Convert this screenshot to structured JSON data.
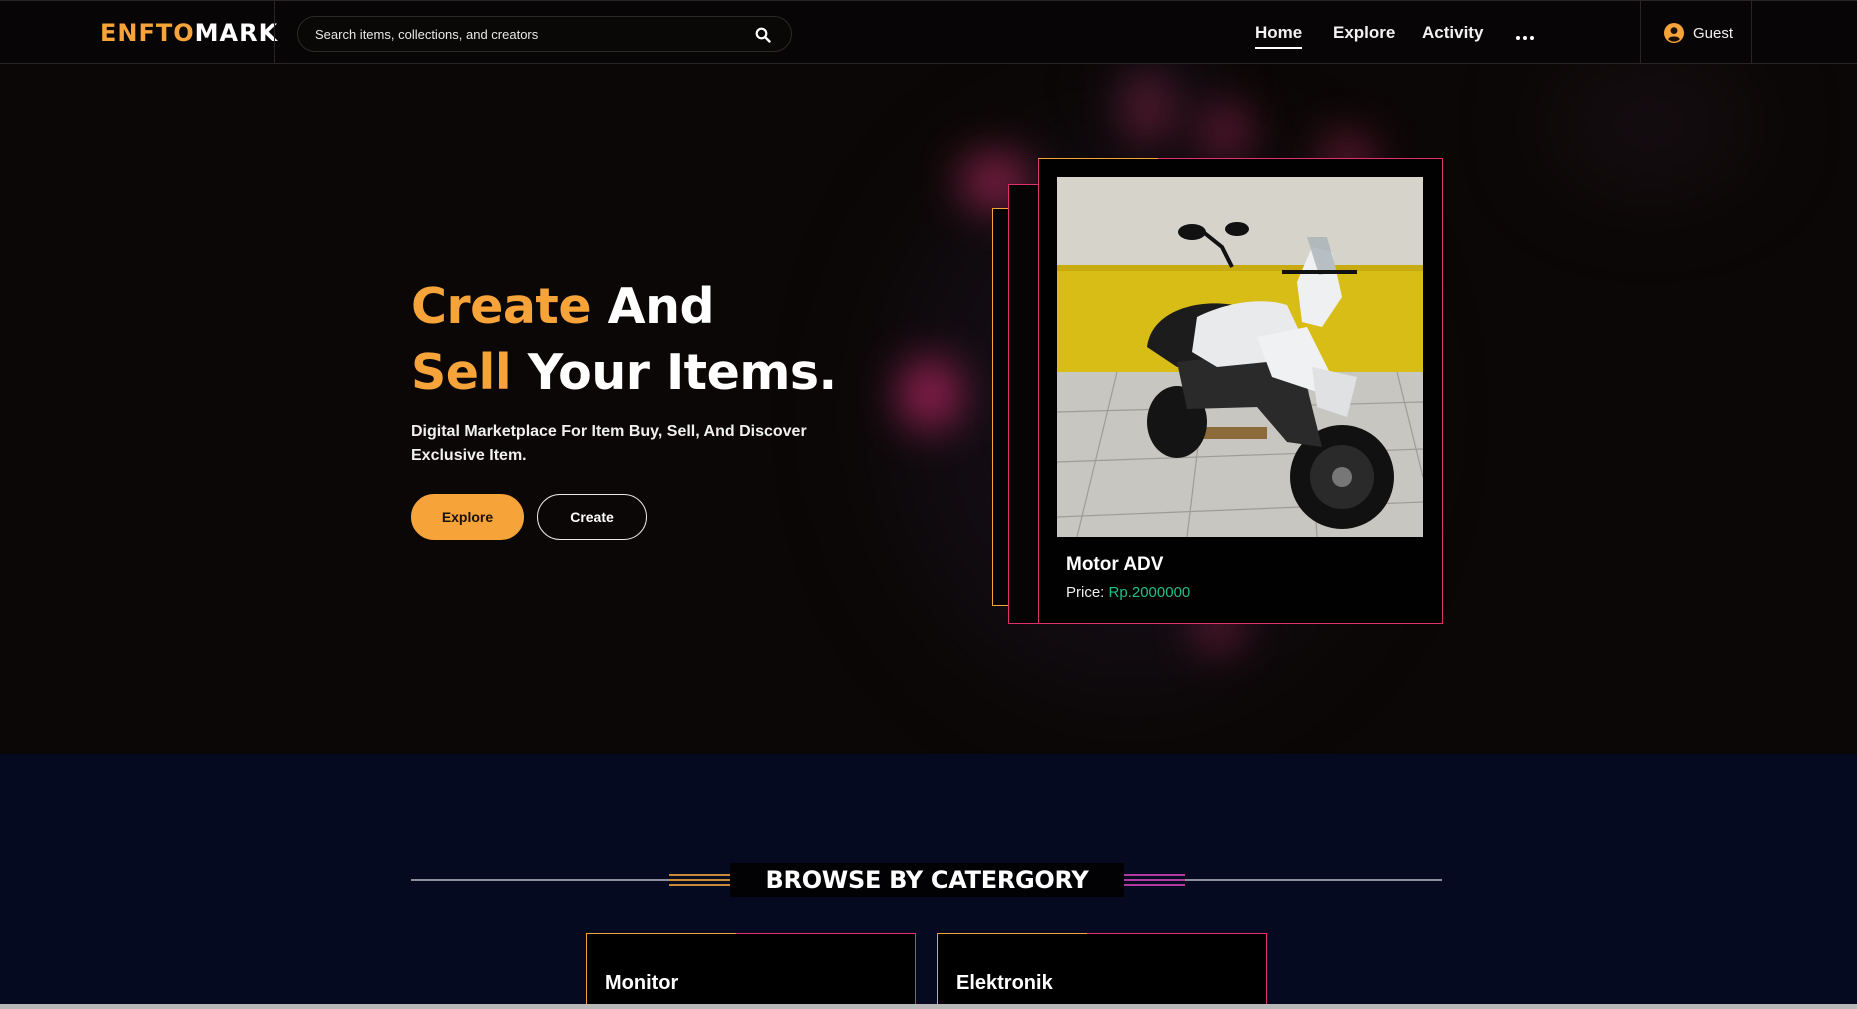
{
  "header": {
    "logo_part1": "ENFTO",
    "logo_part2": "MARK",
    "search_placeholder": "Search items, collections, and creators",
    "nav": {
      "home": "Home",
      "explore": "Explore",
      "activity": "Activity"
    },
    "user_label": "Guest"
  },
  "hero": {
    "title_word1": "Create",
    "title_word2": "And",
    "title_word3": "Sell",
    "title_word4": "Your Items.",
    "subtitle": "Digital Marketplace For Item Buy, Sell, And Discover Exclusive Item.",
    "explore_button": "Explore",
    "create_button": "Create",
    "featured": {
      "name": "Motor ADV",
      "price_label": "Price:",
      "price_value": "Rp.2000000"
    }
  },
  "browse": {
    "title": "BROWSE BY CATERGORY",
    "categories": [
      "Monitor",
      "Elektronik"
    ]
  },
  "colors": {
    "accent": "#f6a33a",
    "pink": "#e0306e",
    "price_green": "#1fc08a",
    "browse_bg": "#050a21"
  }
}
